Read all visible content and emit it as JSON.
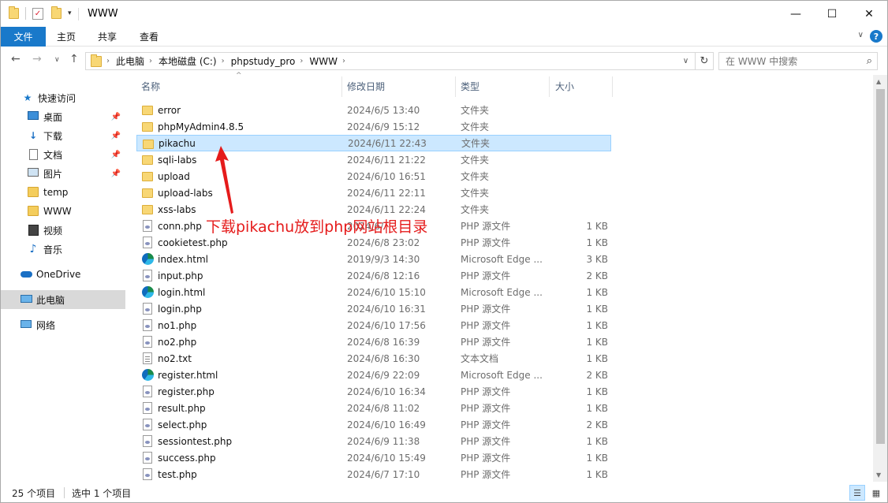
{
  "window": {
    "title": "WWW",
    "controls": {
      "minimize": "—",
      "maximize": "☐",
      "close": "✕"
    }
  },
  "ribbon": {
    "file_tab": "文件",
    "tabs": [
      "主页",
      "共享",
      "查看"
    ]
  },
  "address": {
    "breadcrumbs": [
      "此电脑",
      "本地磁盘 (C:)",
      "phpstudy_pro",
      "WWW"
    ],
    "search_placeholder": "在 WWW 中搜索"
  },
  "sidebar": {
    "items": [
      {
        "label": "快速访问",
        "icon": "star-icon",
        "pinned": false
      },
      {
        "label": "桌面",
        "icon": "desktop-icon",
        "pinned": true
      },
      {
        "label": "下载",
        "icon": "download-icon",
        "pinned": true
      },
      {
        "label": "文档",
        "icon": "document-icon",
        "pinned": true
      },
      {
        "label": "图片",
        "icon": "pictures-icon",
        "pinned": true
      },
      {
        "label": "temp",
        "icon": "folder-icon",
        "pinned": false
      },
      {
        "label": "WWW",
        "icon": "folder-icon",
        "pinned": false
      },
      {
        "label": "视频",
        "icon": "video-icon",
        "pinned": false
      },
      {
        "label": "音乐",
        "icon": "music-icon",
        "pinned": false
      },
      {
        "label": "OneDrive",
        "icon": "cloud-icon",
        "pinned": false
      },
      {
        "label": "此电脑",
        "icon": "computer-icon",
        "pinned": false
      },
      {
        "label": "网络",
        "icon": "network-icon",
        "pinned": false
      }
    ]
  },
  "columns": {
    "name": "名称",
    "date": "修改日期",
    "type": "类型",
    "size": "大小"
  },
  "files": [
    {
      "name": "error",
      "date": "2024/6/5 13:40",
      "type": "文件夹",
      "size": "",
      "icon": "folder"
    },
    {
      "name": "phpMyAdmin4.8.5",
      "date": "2024/6/9 15:12",
      "type": "文件夹",
      "size": "",
      "icon": "folder"
    },
    {
      "name": "pikachu",
      "date": "2024/6/11 22:43",
      "type": "文件夹",
      "size": "",
      "icon": "folder",
      "selected": true
    },
    {
      "name": "sqli-labs",
      "date": "2024/6/11 21:22",
      "type": "文件夹",
      "size": "",
      "icon": "folder"
    },
    {
      "name": "upload",
      "date": "2024/6/10 16:51",
      "type": "文件夹",
      "size": "",
      "icon": "folder"
    },
    {
      "name": "upload-labs",
      "date": "2024/6/11 22:11",
      "type": "文件夹",
      "size": "",
      "icon": "folder"
    },
    {
      "name": "xss-labs",
      "date": "2024/6/11 22:24",
      "type": "文件夹",
      "size": "",
      "icon": "folder"
    },
    {
      "name": "conn.php",
      "date": "2024/6/",
      "type": "PHP 源文件",
      "size": "1 KB",
      "icon": "php"
    },
    {
      "name": "cookietest.php",
      "date": "2024/6/8 23:02",
      "type": "PHP 源文件",
      "size": "1 KB",
      "icon": "php"
    },
    {
      "name": "index.html",
      "date": "2019/9/3 14:30",
      "type": "Microsoft Edge ...",
      "size": "3 KB",
      "icon": "edge"
    },
    {
      "name": "input.php",
      "date": "2024/6/8 12:16",
      "type": "PHP 源文件",
      "size": "2 KB",
      "icon": "php"
    },
    {
      "name": "login.html",
      "date": "2024/6/10 15:10",
      "type": "Microsoft Edge ...",
      "size": "1 KB",
      "icon": "edge"
    },
    {
      "name": "login.php",
      "date": "2024/6/10 16:31",
      "type": "PHP 源文件",
      "size": "1 KB",
      "icon": "php"
    },
    {
      "name": "no1.php",
      "date": "2024/6/10 17:56",
      "type": "PHP 源文件",
      "size": "1 KB",
      "icon": "php"
    },
    {
      "name": "no2.php",
      "date": "2024/6/8 16:39",
      "type": "PHP 源文件",
      "size": "1 KB",
      "icon": "php"
    },
    {
      "name": "no2.txt",
      "date": "2024/6/8 16:30",
      "type": "文本文档",
      "size": "1 KB",
      "icon": "txt"
    },
    {
      "name": "register.html",
      "date": "2024/6/9 22:09",
      "type": "Microsoft Edge ...",
      "size": "2 KB",
      "icon": "edge"
    },
    {
      "name": "register.php",
      "date": "2024/6/10 16:34",
      "type": "PHP 源文件",
      "size": "1 KB",
      "icon": "php"
    },
    {
      "name": "result.php",
      "date": "2024/6/8 11:02",
      "type": "PHP 源文件",
      "size": "1 KB",
      "icon": "php"
    },
    {
      "name": "select.php",
      "date": "2024/6/10 16:49",
      "type": "PHP 源文件",
      "size": "2 KB",
      "icon": "php"
    },
    {
      "name": "sessiontest.php",
      "date": "2024/6/9 11:38",
      "type": "PHP 源文件",
      "size": "1 KB",
      "icon": "php"
    },
    {
      "name": "success.php",
      "date": "2024/6/10 15:49",
      "type": "PHP 源文件",
      "size": "1 KB",
      "icon": "php"
    },
    {
      "name": "test.php",
      "date": "2024/6/7 17:10",
      "type": "PHP 源文件",
      "size": "1 KB",
      "icon": "php"
    }
  ],
  "annotation": {
    "text": "下载pikachu放到php网站根目录",
    "color": "#e51b1b"
  },
  "status": {
    "count": "25 个项目",
    "selected": "选中 1 个项目"
  },
  "colors": {
    "accent": "#1979ca",
    "selection": "#cce8ff"
  }
}
